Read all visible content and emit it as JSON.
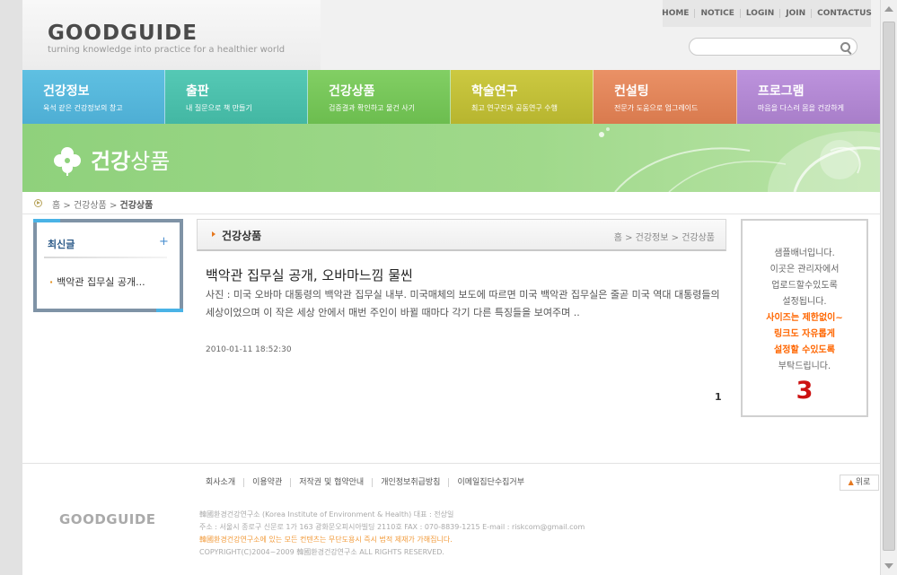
{
  "header": {
    "logo": "GOODGUIDE",
    "tagline": "turning knowledge into practice for a healthier world",
    "topnav": [
      "HOME",
      "NOTICE",
      "LOGIN",
      "JOIN",
      "CONTACTUS"
    ],
    "search_placeholder": ""
  },
  "mainnav": [
    {
      "title": "건강정보",
      "sub": "육석 같은 건강정보의 창고",
      "color": "#59b8db"
    },
    {
      "title": "출판",
      "sub": "내 질문으로 책 만들기",
      "color": "#4fc3b0"
    },
    {
      "title": "건강상품",
      "sub": "검증결과 확인하고 물건 사기",
      "color": "#7ac95c"
    },
    {
      "title": "학술연구",
      "sub": "최고 연구진과 공동연구 수행",
      "color": "#c6c43a"
    },
    {
      "title": "컨설팅",
      "sub": "전문가 도움으로 업그레이드",
      "color": "#e58a5e"
    },
    {
      "title": "프로그램",
      "sub": "마음을 다스려 몸을 건강하게",
      "color": "#b58ad6"
    }
  ],
  "banner": {
    "title_bold": "건강",
    "title_rest": "상품"
  },
  "breadcrumb": {
    "home": "홈",
    "level1": "건강상품",
    "current": "건강상품"
  },
  "leftbox": {
    "title": "최신글",
    "plus": "+",
    "item": "백악관 집무실 공개..."
  },
  "content": {
    "title": "건강상품",
    "location": "홈 > 건강정보 > 건강상품",
    "post_title": "백악관 집무실 공개, 오바마느낌 물씬",
    "post_body": "사진 : 미국 오바마 대통령의 백악관 집무실 내부. 미국매체의 보도에 따르면 미국 백악관 집무실은 줄곧 미국 역대 대통령들의 세상이었으며 이 작은 세상 안에서 매번 주인이 바뀔 때마다 각기 다른 특징들을 보여주며 ..",
    "post_date": "2010-01-11 18:52:30",
    "page": "1"
  },
  "rightbanner": {
    "lines": [
      "샘플배너입니다.",
      "이곳은 관리자에서",
      "업로드할수있도록",
      "설정됩니다."
    ],
    "highlight": [
      "사이즈는 제한없이~",
      "링크도 자유롭게",
      "설정할 수있도록"
    ],
    "end": "부탁드립니다.",
    "number": "3"
  },
  "footer": {
    "links": [
      "회사소개",
      "이용약관",
      "저작권 및 협약안내",
      "개인정보취급방침",
      "이메일집단수집거부"
    ],
    "totop": "위로",
    "logo": "GOODGUIDE",
    "info1": "韓國환경건강연구소 (Korea Institute of Environment & Health)  대표 : 전상일",
    "info2": "주소 : 서울시 종로구 신문로 1가 163 광화문오피시아빌딩 2110호  FAX : 070-8839-1215    E-mail : riskcom@gmail.com",
    "warning": "韓國환경건강연구소에 있는 모든 컨텐츠는 무단도용시 즉시 법적 제재가 가해집니다.",
    "copyright": "COPYRIGHT(C)2004~2009  韓國환경건강연구소  ALL RIGHTS RESERVED."
  }
}
